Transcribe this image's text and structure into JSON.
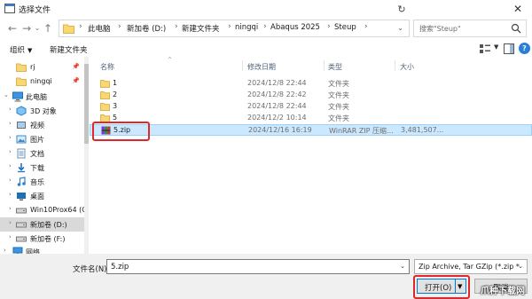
{
  "window": {
    "title": "选择文件",
    "close_glyph": "✕"
  },
  "nav": {
    "back_glyph": "←",
    "forward_glyph": "→",
    "up_glyph": "↑",
    "recent_glyph": "⌄",
    "refresh_glyph": "↻"
  },
  "breadcrumb": [
    "此电脑",
    "新加卷 (D:)",
    "新建文件夹",
    "ningqi",
    "Abaqus 2025",
    "Steup"
  ],
  "search": {
    "placeholder": "搜索\"Steup\""
  },
  "toolbar": {
    "organize": "组织",
    "new_folder": "新建文件夹"
  },
  "sidebar": {
    "items": [
      {
        "label": "rj",
        "icon": "folder-icon",
        "pinned": true
      },
      {
        "label": "ningqi",
        "icon": "folder-icon",
        "pinned": true
      },
      {
        "label": "此电脑",
        "icon": "pc-icon"
      },
      {
        "label": "3D 对象",
        "icon": "3d-objects-icon"
      },
      {
        "label": "视频",
        "icon": "video-icon"
      },
      {
        "label": "图片",
        "icon": "pictures-icon"
      },
      {
        "label": "文档",
        "icon": "documents-icon"
      },
      {
        "label": "下载",
        "icon": "downloads-icon"
      },
      {
        "label": "音乐",
        "icon": "music-icon"
      },
      {
        "label": "桌面",
        "icon": "desktop-icon"
      },
      {
        "label": "Win10Prox64 (C",
        "icon": "drive-icon"
      },
      {
        "label": "新加卷 (D:)",
        "icon": "drive-icon",
        "selected": true
      },
      {
        "label": "新加卷 (F:)",
        "icon": "drive-icon"
      },
      {
        "label": "网络",
        "icon": "network-icon"
      }
    ]
  },
  "columns": {
    "name": "名称",
    "date": "修改日期",
    "type": "类型",
    "size": "大小"
  },
  "files": [
    {
      "name": "1",
      "date": "2024/12/8 22:44",
      "type": "文件夹",
      "size": "",
      "icon": "folder-icon"
    },
    {
      "name": "2",
      "date": "2024/12/8 22:42",
      "type": "文件夹",
      "size": "",
      "icon": "folder-icon"
    },
    {
      "name": "3",
      "date": "2024/12/8 22:44",
      "type": "文件夹",
      "size": "",
      "icon": "folder-icon"
    },
    {
      "name": "5",
      "date": "2024/12/2 10:14",
      "type": "文件夹",
      "size": "",
      "icon": "folder-icon"
    },
    {
      "name": "5.zip",
      "date": "2024/12/16 16:19",
      "type": "WinRAR ZIP 压缩...",
      "size": "3,481,507...",
      "icon": "winrar-zip-icon",
      "selected": true
    }
  ],
  "footer": {
    "filename_label": "文件名(N):",
    "filename_value": "5.zip",
    "filetype_value": "Zip Archive, Tar GZip (*.zip *",
    "open_label": "打开(O)",
    "cancel_label": "取消"
  },
  "watermark": "爪种下载网",
  "colors": {
    "accent": "#0078d7",
    "selection": "#cce8ff",
    "highlight": "#e0272b",
    "folder": "#f8d775"
  }
}
